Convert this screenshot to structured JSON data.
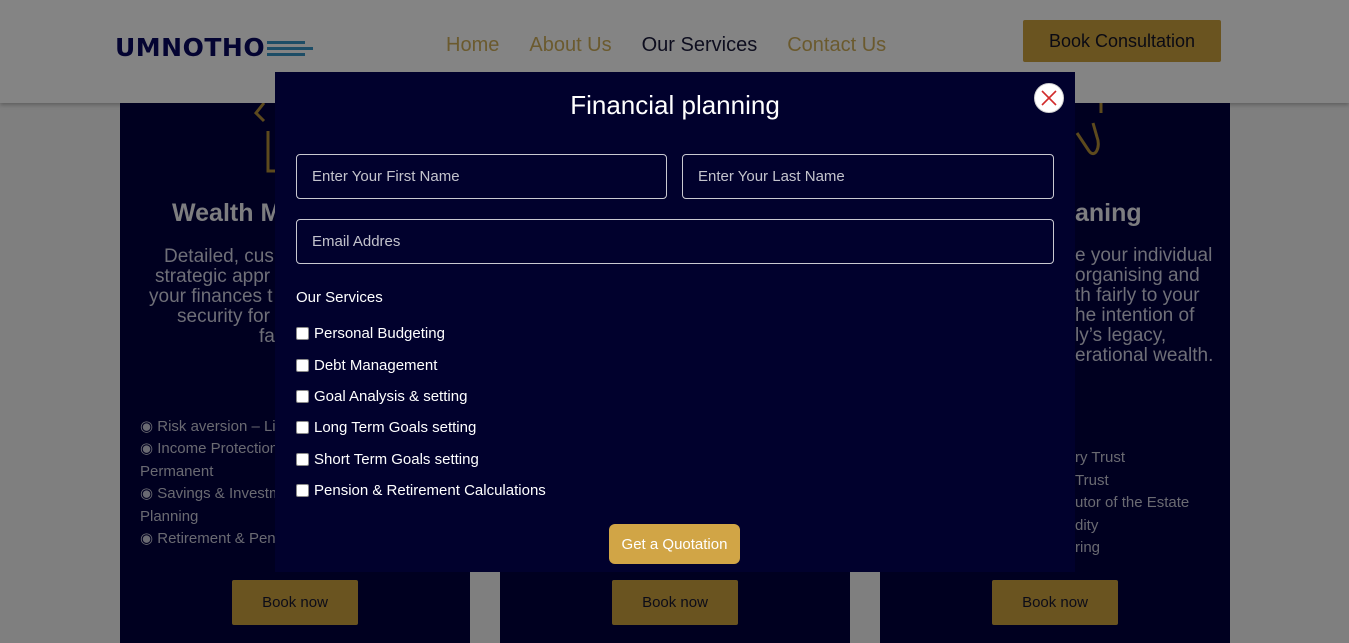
{
  "header": {
    "logo_text": "UMNOTHO",
    "nav": [
      "Home",
      "About Us",
      "Our Services",
      "Contact Us"
    ],
    "active_nav": "Our Services",
    "cta_label": "Book Consultation"
  },
  "cards": [
    {
      "title": "Wealth M",
      "desc": [
        "Detailed, cus",
        "strategic appr",
        "your finances t",
        "security for",
        "fa"
      ],
      "items": [
        "◉ Risk aversion – Lif",
        "◉ Income Protection",
        "Permanent",
        "◉ Savings & Investm",
        "Planning",
        "◉ Retirement & Pens"
      ],
      "button": "Book now"
    },
    {
      "title": "",
      "desc": [],
      "items": [],
      "button": "Book now"
    },
    {
      "title": "aning",
      "desc": [
        "e your individual",
        "organising and",
        "th fairly to your",
        "he intention of",
        "ly’s legacy,",
        "erational wealth."
      ],
      "items": [
        "ry Trust",
        "Trust",
        "utor of the Estate",
        "dity",
        "ring"
      ],
      "button": "Book now"
    }
  ],
  "modal": {
    "title": "Financial planning",
    "first_name_placeholder": "Enter Your First Name",
    "last_name_placeholder": "Enter Your Last Name",
    "email_placeholder": "Email Addres",
    "services_label": "Our Services",
    "services": [
      "Personal Budgeting",
      "Debt Management",
      "Goal Analysis & setting",
      "Long Term Goals setting",
      "Short Term Goals setting",
      "Pension & Retirement Calculations"
    ],
    "submit_label": "Get a Quotation"
  },
  "colors": {
    "modal_bg": "#01012d",
    "card_bg": "#000020",
    "gold": "#d1a546",
    "close_x": "#d22b2b"
  },
  "icons": [
    "close-icon",
    "logo-lines-icon",
    "card-icon"
  ]
}
